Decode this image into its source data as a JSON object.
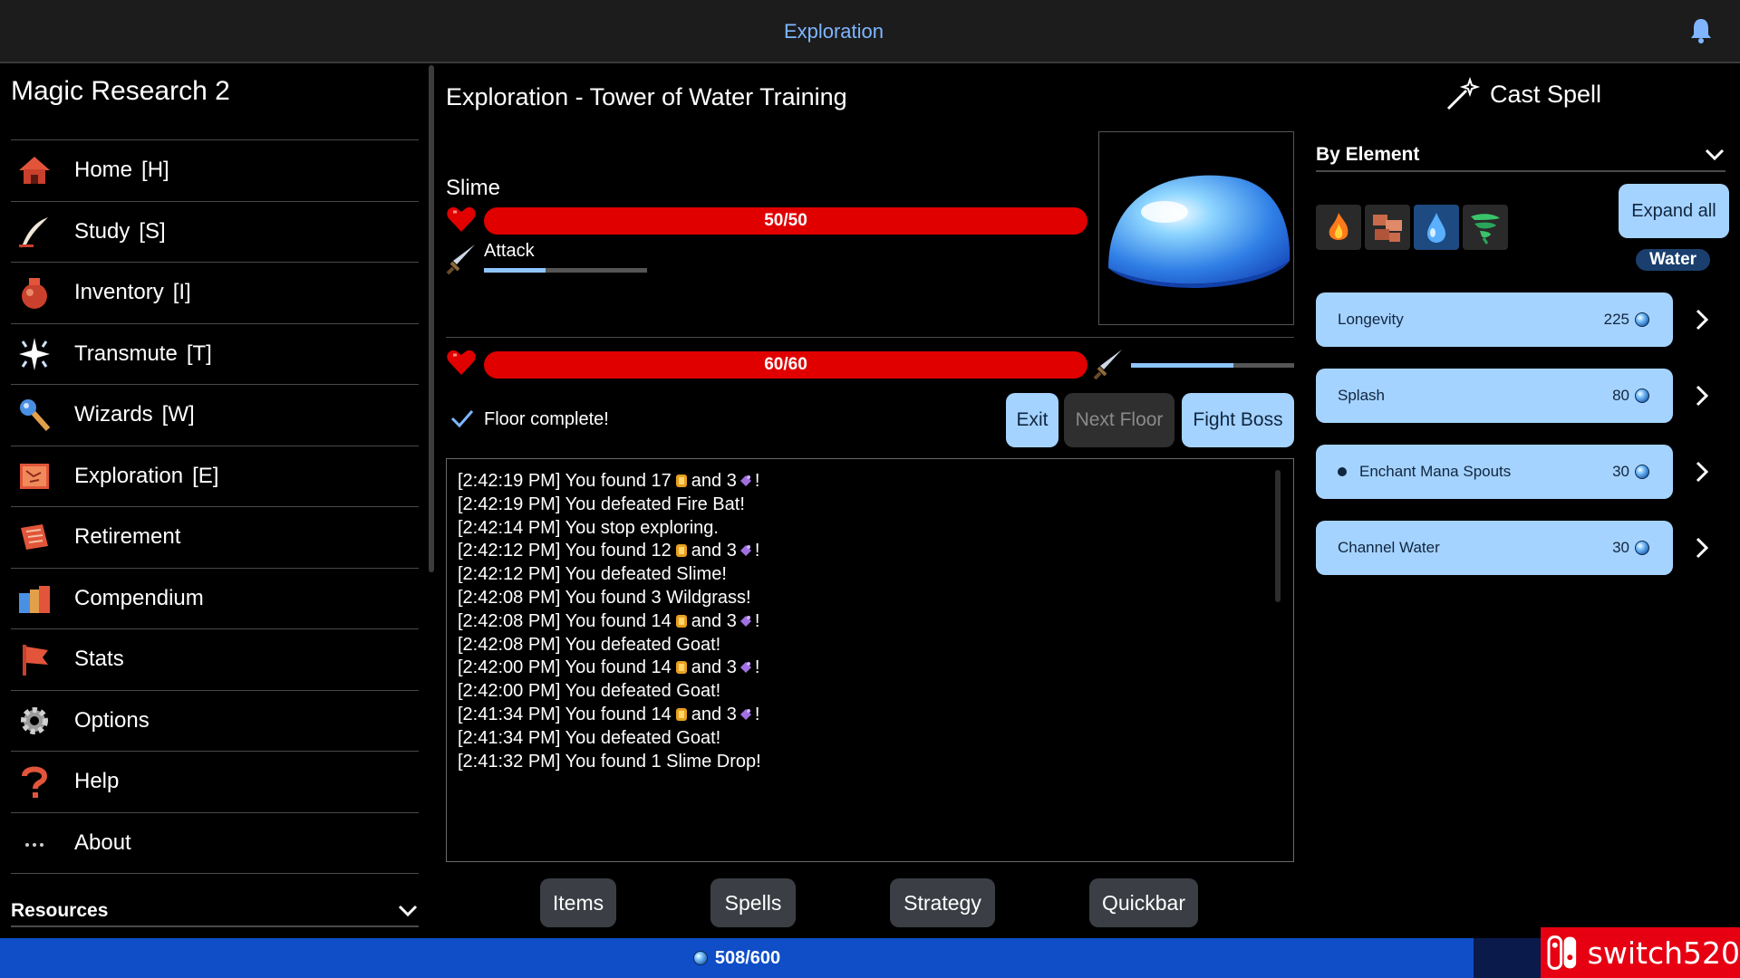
{
  "header": {
    "title": "Exploration"
  },
  "sidebar": {
    "app_title": "Magic Research 2",
    "items": [
      {
        "label": "Home",
        "key": "[H]"
      },
      {
        "label": "Study",
        "key": "[S]"
      },
      {
        "label": "Inventory",
        "key": "[I]"
      },
      {
        "label": "Transmute",
        "key": "[T]"
      },
      {
        "label": "Wizards",
        "key": "[W]"
      },
      {
        "label": "Exploration",
        "key": "[E]"
      },
      {
        "label": "Retirement",
        "key": ""
      },
      {
        "label": "Compendium",
        "key": ""
      },
      {
        "label": "Stats",
        "key": ""
      },
      {
        "label": "Options",
        "key": ""
      },
      {
        "label": "Help",
        "key": ""
      },
      {
        "label": "About",
        "key": ""
      }
    ],
    "resources_label": "Resources"
  },
  "main": {
    "title": "Exploration - Tower of Water Training",
    "enemy": {
      "name": "Slime",
      "hp_text": "50/50",
      "hp_fraction": 1.0,
      "attack_label": "Attack",
      "attack_progress": 0.38
    },
    "player": {
      "hp_text": "60/60",
      "hp_fraction": 1.0,
      "attack_progress": 0.63
    },
    "floor_status": "Floor complete!",
    "buttons": {
      "exit": "Exit",
      "next_floor": "Next Floor",
      "fight_boss": "Fight Boss"
    },
    "log": [
      {
        "pre": "[2:42:19 PM] You found 17",
        "mid": "and 3",
        "post": "!",
        "icons": true
      },
      {
        "text": "[2:42:19 PM] You defeated Fire Bat!"
      },
      {
        "text": "[2:42:14 PM] You stop exploring."
      },
      {
        "pre": "[2:42:12 PM] You found 12",
        "mid": "and 3",
        "post": "!",
        "icons": true
      },
      {
        "text": "[2:42:12 PM] You defeated Slime!"
      },
      {
        "text": "[2:42:08 PM] You found 3 Wildgrass!"
      },
      {
        "pre": "[2:42:08 PM] You found 14",
        "mid": "and 3",
        "post": "!",
        "icons": true
      },
      {
        "text": "[2:42:08 PM] You defeated Goat!"
      },
      {
        "pre": "[2:42:00 PM] You found 14",
        "mid": "and 3",
        "post": "!",
        "icons": true
      },
      {
        "text": "[2:42:00 PM] You defeated Goat!"
      },
      {
        "pre": "[2:41:34 PM] You found 14",
        "mid": "and 3",
        "post": "!",
        "icons": true
      },
      {
        "text": "[2:41:34 PM] You defeated Goat!"
      },
      {
        "text": "[2:41:32 PM] You found 1 Slime Drop!"
      }
    ],
    "tabs": [
      "Items",
      "Spells",
      "Strategy",
      "Quickbar"
    ]
  },
  "spells_panel": {
    "cast_label": "Cast Spell",
    "filter_label": "By Element",
    "expand_label": "Expand all",
    "selected_element": "Water",
    "elements": [
      "fire-icon",
      "earth-icon",
      "water-icon",
      "wind-icon"
    ],
    "spells": [
      {
        "name": "Longevity",
        "cost": "225",
        "active": false
      },
      {
        "name": "Splash",
        "cost": "80",
        "active": false
      },
      {
        "name": "Enchant Mana Spouts",
        "cost": "30",
        "active": true
      },
      {
        "name": "Channel Water",
        "cost": "30",
        "active": false
      }
    ]
  },
  "footer": {
    "mana": "508/600"
  },
  "watermark": {
    "text": "switch520"
  },
  "colors": {
    "accent": "#a5d3ff",
    "hp": "#e00000",
    "footer": "#0f4ec7",
    "title": "#7fb6ff"
  }
}
